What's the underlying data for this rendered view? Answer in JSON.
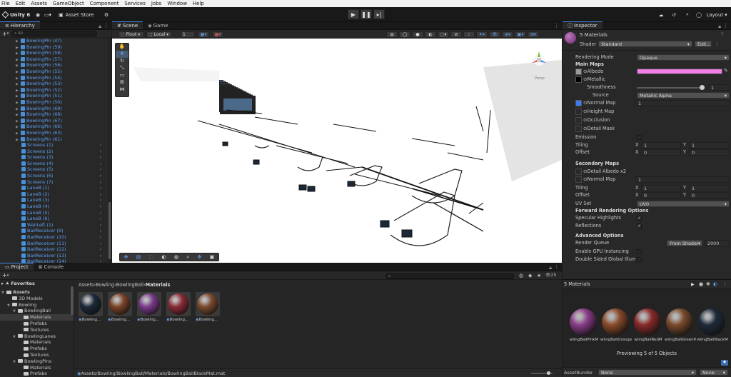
{
  "menu": [
    "File",
    "Edit",
    "Assets",
    "GameObject",
    "Component",
    "Services",
    "Jobs",
    "Window",
    "Help"
  ],
  "toolbar": {
    "account": "Unity 6",
    "asset_store": "Asset Store",
    "layout": "Layout"
  },
  "hierarchy": {
    "tab": "Hierarchy",
    "search": "All",
    "rows": [
      {
        "name": "BowlingPin (47)",
        "type": "pin"
      },
      {
        "name": "BowlingPin (59)",
        "type": "pin"
      },
      {
        "name": "BowlingPin (58)",
        "type": "pin"
      },
      {
        "name": "BowlingPin (57)",
        "type": "pin"
      },
      {
        "name": "BowlingPin (56)",
        "type": "pin"
      },
      {
        "name": "BowlingPin (55)",
        "type": "pin"
      },
      {
        "name": "BowlingPin (54)",
        "type": "pin"
      },
      {
        "name": "BowlingPin (53)",
        "type": "pin"
      },
      {
        "name": "BowlingPin (52)",
        "type": "pin"
      },
      {
        "name": "BowlingPin (51)",
        "type": "pin"
      },
      {
        "name": "BowlingPin (50)",
        "type": "pin"
      },
      {
        "name": "BowlingPin (69)",
        "type": "pin"
      },
      {
        "name": "BowlingPin (68)",
        "type": "pin"
      },
      {
        "name": "BowlingPin (67)",
        "type": "pin"
      },
      {
        "name": "BowlingPin (66)",
        "type": "pin"
      },
      {
        "name": "BowlingPin (63)",
        "type": "pin"
      },
      {
        "name": "BowlingPin (61)",
        "type": "pin"
      },
      {
        "name": "Screens (1)",
        "type": "obj"
      },
      {
        "name": "Screens (2)",
        "type": "obj"
      },
      {
        "name": "Screens (3)",
        "type": "obj"
      },
      {
        "name": "Screens (4)",
        "type": "obj"
      },
      {
        "name": "Screens (5)",
        "type": "obj"
      },
      {
        "name": "Screens (6)",
        "type": "obj"
      },
      {
        "name": "Screens (7)",
        "type": "obj"
      },
      {
        "name": "LaneB (1)",
        "type": "obj"
      },
      {
        "name": "LaneB (2)",
        "type": "obj"
      },
      {
        "name": "LaneB (3)",
        "type": "obj"
      },
      {
        "name": "LaneB (4)",
        "type": "obj"
      },
      {
        "name": "LaneB (5)",
        "type": "obj"
      },
      {
        "name": "LaneB (6)",
        "type": "obj"
      },
      {
        "name": "WallLeft (1)",
        "type": "obj"
      },
      {
        "name": "BallReceiver (9)",
        "type": "obj"
      },
      {
        "name": "BallReceiver (10)",
        "type": "obj"
      },
      {
        "name": "BallReceiver (11)",
        "type": "obj"
      },
      {
        "name": "BallReceiver (12)",
        "type": "obj"
      },
      {
        "name": "BallReceiver (13)",
        "type": "obj"
      },
      {
        "name": "BallReceiver (14)",
        "type": "obj"
      }
    ]
  },
  "scene": {
    "tabs": [
      "Scene",
      "Game"
    ],
    "pivot": "Pivot",
    "local": "Local",
    "grid_value": "1",
    "persp": "Persp"
  },
  "inspector": {
    "tab": "Inspector",
    "title": "5 Materials",
    "shader_label": "Shader",
    "shader": "Standard",
    "edit": "Edit...",
    "rendering_mode_label": "Rendering Mode",
    "rendering_mode": "Opaque",
    "main_maps": "Main Maps",
    "albedo": "Albedo",
    "metallic": "Metallic",
    "smoothness": "Smoothness",
    "smoothness_value": "1",
    "smoothness_fraction": 1.0,
    "source_label": "Source",
    "source": "Metallic Alpha",
    "normal_map": "Normal Map",
    "normal_value": "1",
    "height_map": "Height Map",
    "occlusion": "Occlusion",
    "detail_mask": "Detail Mask",
    "emission": "Emission",
    "tiling": "Tiling",
    "offset": "Offset",
    "x": "X",
    "y": "Y",
    "tiling_x": "1",
    "tiling_y": "1",
    "offset_x": "0",
    "offset_y": "0",
    "secondary_maps": "Secondary Maps",
    "detail_albedo": "Detail Albedo x2",
    "sec_normal": "Normal Map",
    "sec_normal_value": "1",
    "sec_tiling_x": "1",
    "sec_tiling_y": "1",
    "sec_offset_x": "0",
    "sec_offset_y": "0",
    "uv_set_label": "UV Set",
    "uv_set": "UV0",
    "forward_options": "Forward Rendering Options",
    "specular": "Specular Highlights",
    "reflections": "Reflections",
    "advanced": "Advanced Options",
    "render_queue": "Render Queue",
    "render_queue_mode": "From Shader",
    "render_queue_value": "2000",
    "gpu_instancing": "Enable GPU Instancing",
    "double_sided": "Double Sided Global Illumin",
    "preview_header": "5 Materials",
    "previewing": "Previewing 5 of 5 Objects",
    "asset_bundle_label": "AssetBundle",
    "asset_bundle": "None",
    "asset_variant": "None",
    "albedo_color": "#f07fe8"
  },
  "materials_preview": [
    {
      "label": "wlingBallPinkM",
      "color": "#8b3c8a"
    },
    {
      "label": "wlingBallOrange",
      "color": "#8a4a2a"
    },
    {
      "label": "wlingBallRedM",
      "color": "#8a2a2a"
    },
    {
      "label": "wlingBallGreenM",
      "color": "#7a4a2c"
    },
    {
      "label": "wlingBallBlackM",
      "color": "#1e2a3a"
    }
  ],
  "project": {
    "tabs": [
      "Project",
      "Console"
    ],
    "favorites": "Favorites",
    "breadcrumb": [
      "Assets",
      "Bowling",
      "BowlingBall",
      "Materials"
    ],
    "zoom_count": "25",
    "tree": [
      {
        "name": "Assets",
        "depth": 0,
        "open": true
      },
      {
        "name": "3D Models",
        "depth": 1,
        "open": false
      },
      {
        "name": "Bowling",
        "depth": 1,
        "open": true
      },
      {
        "name": "BowlingBall",
        "depth": 2,
        "open": true
      },
      {
        "name": "Materials",
        "depth": 3,
        "open": false,
        "selected": true
      },
      {
        "name": "Prefabs",
        "depth": 3,
        "open": false
      },
      {
        "name": "Textures",
        "depth": 3,
        "open": false
      },
      {
        "name": "BowlingLanes",
        "depth": 2,
        "open": true
      },
      {
        "name": "Materials",
        "depth": 3,
        "open": false
      },
      {
        "name": "Prefabs",
        "depth": 3,
        "open": false
      },
      {
        "name": "Textures",
        "depth": 3,
        "open": false
      },
      {
        "name": "BowlingPins",
        "depth": 2,
        "open": true
      },
      {
        "name": "Materials",
        "depth": 3,
        "open": false
      },
      {
        "name": "Prefabs",
        "depth": 3,
        "open": false
      }
    ],
    "assets": [
      {
        "label": "Bowling...",
        "color": "#1c2838"
      },
      {
        "label": "Bowling...",
        "color": "#7a4228"
      },
      {
        "label": "Bowling...",
        "color": "#7a3a8a"
      },
      {
        "label": "Bowling...",
        "color": "#8a2a35"
      },
      {
        "label": "Bowling...",
        "color": "#7a4a2e"
      }
    ],
    "status_path": "Assets/Bowling/BowlingBall/Materials/BowlingBallBlackMat.mat"
  },
  "icons": {
    "play": "play-icon",
    "pause": "pause-icon",
    "step": "step-icon"
  }
}
